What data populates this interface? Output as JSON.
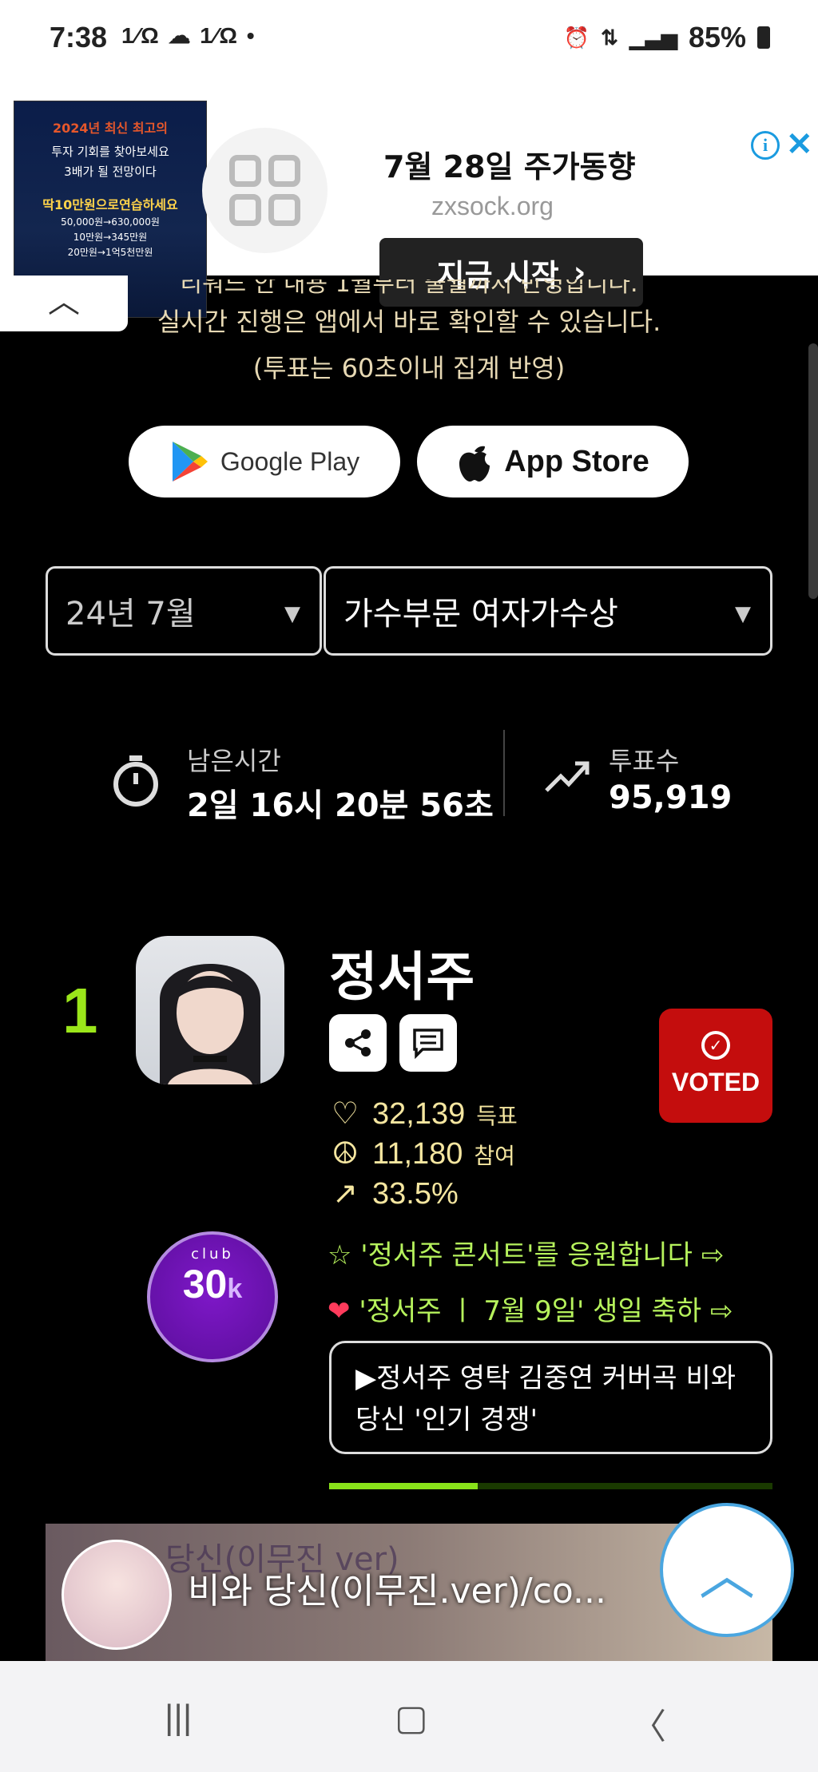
{
  "status": {
    "time": "7:38",
    "left_icons": "1⁄Ω ☁ 1⁄Ω •",
    "battery": "85%",
    "right_icons": [
      "alarm-icon",
      "5g-icon",
      "signal-icon"
    ]
  },
  "ad": {
    "image_lines": [
      "2024년 최신 최고의",
      "투자 기회를 찾아보세요",
      "3배가 될 전망이다",
      "딱10만원으로연습하세요",
      "50,000원→630,000원",
      "10만원→345만원",
      "20만원→1억5천만원"
    ],
    "title": "7월 28일 주가동향",
    "domain": "zxsock.org",
    "cta": "지금 시작",
    "info": "i",
    "close": "✕"
  },
  "info": {
    "line1": "리워드 안 내용 1월부터 출월까지 반영합니다.",
    "line2": "실시간 진행은 앱에서 바로 확인할 수 있습니다.",
    "line3": "(투표는 60초이내 집계 반영)"
  },
  "stores": {
    "google": "Google Play",
    "apple": "App Store"
  },
  "filters": {
    "month": "24년 7월",
    "category": "가수부문 여자가수상"
  },
  "stats": {
    "time_label": "남은시간",
    "time_value": "2일 16시 20분 56초",
    "votes_label": "투표수",
    "votes_value": "95,919"
  },
  "candidate": {
    "rank": "1",
    "name": "정서주",
    "voted": "VOTED",
    "votes": "32,139",
    "votes_unit": "득표",
    "participants": "11,180",
    "participants_unit": "참여",
    "percent": "33.5%",
    "percent_fraction": 0.335,
    "club_label": "club",
    "club_value": "30",
    "club_suffix": "k",
    "cheer1": "☆ '정서주 콘서트'를 응원합니다 ⇨",
    "cheer2": "'정서주 ㅣ 7월 9일' 생일 축하 ⇨",
    "news": "▶정서주 영탁 김중연 커버곡 비와 당신 '인기 경쟁'"
  },
  "video": {
    "title": "비와 당신(이무진.ver)/co...",
    "watermark": "당신(이무진 ver)"
  },
  "colors": {
    "accent_green": "#9be61a",
    "voted_red": "#c40d0d",
    "club_purple": "#6a12b0",
    "metric_yellow": "#f5e6a0"
  }
}
